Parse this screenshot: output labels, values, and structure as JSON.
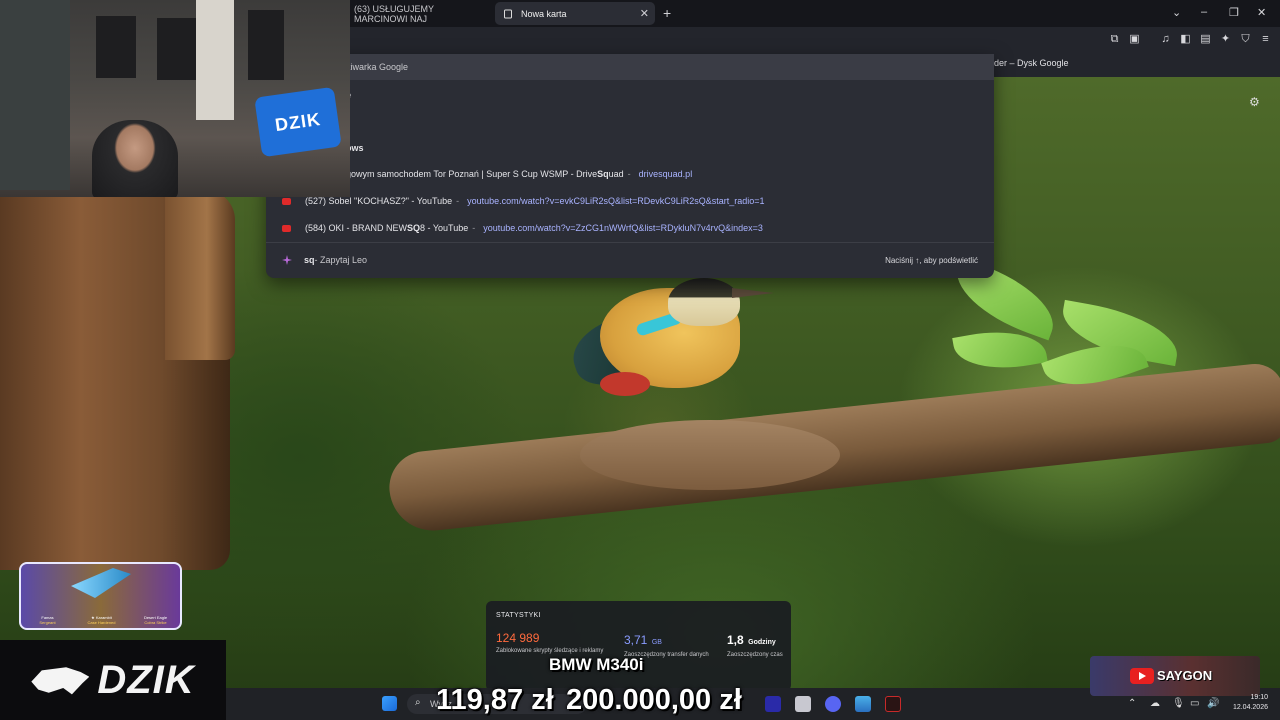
{
  "browser": {
    "tabs": [
      {
        "label": "(63) USŁUGUJEMY MARCINOWI NAJ",
        "active": false
      },
      {
        "label": "Nowa karta",
        "active": true
      }
    ],
    "new_tab_icon": "plus-icon",
    "window_controls": [
      "chevron-down-icon",
      "minimize-icon",
      "restore-icon",
      "close-icon"
    ],
    "bookmark_partial": "ider – Dysk Google"
  },
  "omnibox": {
    "search_row": "kiwarka Google",
    "partial_lines": [
      "e",
      "ows"
    ],
    "suggestions": [
      {
        "pre": "gowym samochodem Tor Poznań | Super S Cup WSMP - Drive ",
        "bold": "Sq",
        "post": "uad",
        "sep": " - ",
        "url": "drivesquad.pl",
        "icon": ""
      },
      {
        "pre": "(527) Sobel \"KOCHASZ?\" - YouTube",
        "bold": "",
        "post": "",
        "sep": " - ",
        "url": "youtube.com/watch?v=evkC9LiR2sQ&list=RDevkC9LiR2sQ&start_radio=1",
        "icon": "youtube-icon"
      },
      {
        "pre": "(584) OKI - BRAND NEW ",
        "bold": "SQ",
        "post": "8 - YouTube",
        "sep": " - ",
        "url": "youtube.com/watch?v=ZzCG1nWWrfQ&list=RDykluN7v4rvQ&index=3",
        "icon": "youtube-icon"
      }
    ],
    "leo": {
      "query": "sq",
      "label": " - Zapytaj Leo",
      "hint": "Naciśnij ↑, aby podświetlić"
    }
  },
  "stats": {
    "title": "STATYSTYKI",
    "trackers": {
      "value": "124 989",
      "label": "Zablokowane skrypty śledzące i reklamy",
      "color": "#ff6a3d"
    },
    "bandwidth": {
      "value": "3,71",
      "unit": "GB",
      "label": "Zaoszczędzony transfer danych",
      "color": "#8a9cff"
    },
    "time": {
      "value": "1,8",
      "unit": "Godziny",
      "label": "Zaoszczędzony czas",
      "color": "#ffffff"
    }
  },
  "overlay": {
    "car": "BMW M340i",
    "price_small": "119,87 zł",
    "price_big": "200.000,00 zł",
    "brand": "DZIK",
    "brand_mark": "DZIK",
    "channel": "SAYGON",
    "skins": [
      {
        "name": "Famas",
        "sub": "Sergeant"
      },
      {
        "name": "★ Karambit",
        "sub": "Case Hardened"
      },
      {
        "name": "Desert Eagle",
        "sub": "Cobra Strike"
      }
    ]
  },
  "taskbar": {
    "search_placeholder": "Wysz",
    "time": "19:10",
    "date": "12.04.2026"
  },
  "colors": {
    "accent": "#a9b3ff",
    "dropdown_bg": "#2b2d35",
    "taskbar_bg": "#202226"
  }
}
